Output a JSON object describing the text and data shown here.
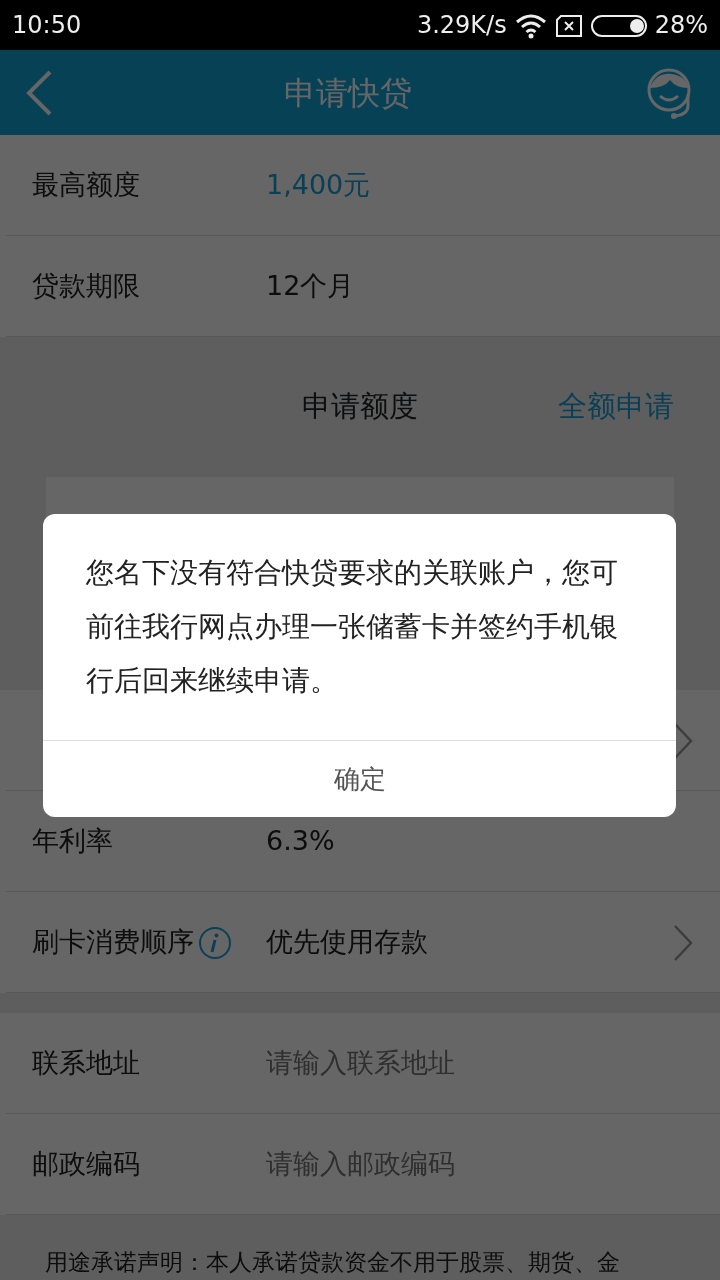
{
  "status_bar": {
    "time": "10:50",
    "speed": "3.29K/s",
    "battery": "28%"
  },
  "header": {
    "title": "申请快贷"
  },
  "rows_top": [
    {
      "label": "最高额度",
      "value": "1,400元",
      "accent": true
    },
    {
      "label": "贷款期限",
      "value": "12个月",
      "accent": false
    }
  ],
  "amount_section": {
    "title": "申请额度",
    "action": "全额申请"
  },
  "rows_mid": [
    {
      "kind": "link",
      "chevron": true,
      "info": false
    },
    {
      "kind": "info",
      "label": "年利率",
      "value": "6.3%",
      "chevron": false,
      "info": false
    },
    {
      "kind": "info",
      "label": "刷卡消费顺序",
      "value": "优先使用存款",
      "chevron": true,
      "info": true
    }
  ],
  "contact_fields": [
    {
      "label": "联系地址",
      "placeholder": "请输入联系地址"
    },
    {
      "label": "邮政编码",
      "placeholder": "请输入邮政编码"
    }
  ],
  "statement": "用途承诺声明：本人承诺贷款资金不用于股票、期货、金",
  "dialog": {
    "message": "您名下没有符合快贷要求的关联账户，您可前往我行网点办理一张储蓄卡并签约手机银行后回来继续申请。",
    "button": "确定"
  }
}
